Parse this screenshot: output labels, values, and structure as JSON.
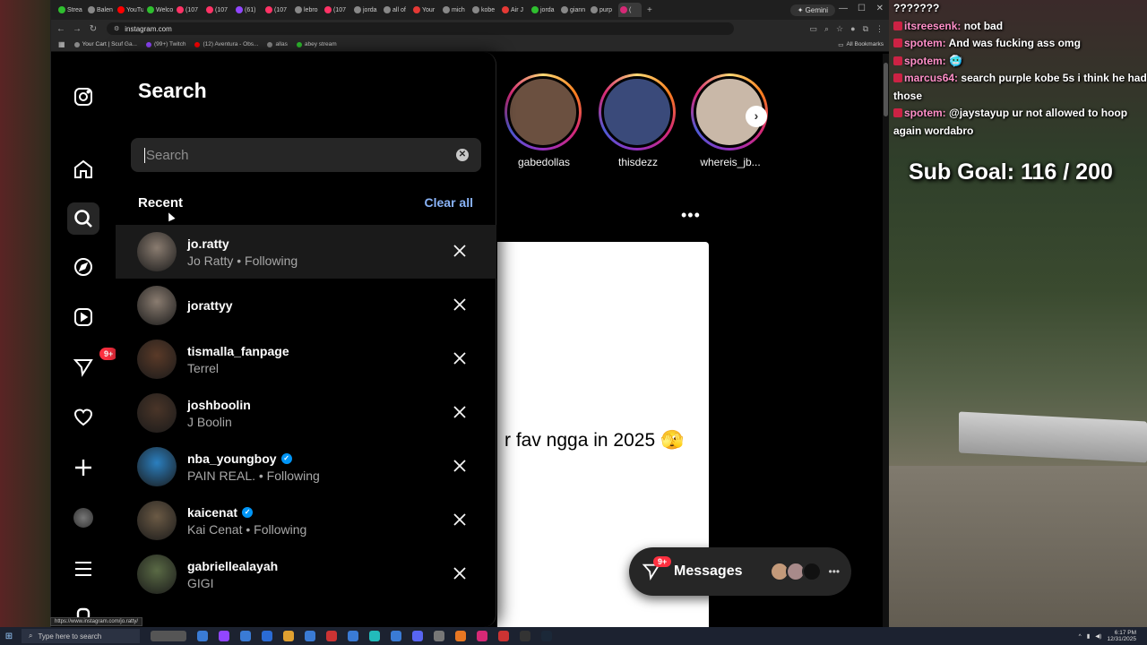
{
  "browser": {
    "tabs": [
      {
        "label": "Strea",
        "color": "#2fbf2f"
      },
      {
        "label": "Balen",
        "color": "#888888"
      },
      {
        "label": "YouTu",
        "color": "#ff0000"
      },
      {
        "label": "Welco",
        "color": "#2fbf2f"
      },
      {
        "label": "(107",
        "color": "#ff3366"
      },
      {
        "label": "(107",
        "color": "#ff3366"
      },
      {
        "label": "(61)",
        "color": "#9146ff"
      },
      {
        "label": "(107",
        "color": "#ff3366"
      },
      {
        "label": "lebro",
        "color": "#888888"
      },
      {
        "label": "(107",
        "color": "#ff3366"
      },
      {
        "label": "jorda",
        "color": "#888888"
      },
      {
        "label": "all of",
        "color": "#888888"
      },
      {
        "label": "Your",
        "color": "#e53935"
      },
      {
        "label": "mich",
        "color": "#888888"
      },
      {
        "label": "kobe",
        "color": "#888888"
      },
      {
        "label": "Air J",
        "color": "#e53935"
      },
      {
        "label": "jorda",
        "color": "#2fbf2f"
      },
      {
        "label": "giann",
        "color": "#888888"
      },
      {
        "label": "purp",
        "color": "#888888"
      },
      {
        "label": "(",
        "color": "#d62976"
      }
    ],
    "gemini_label": "Gemini",
    "url": "instagram.com",
    "bookmarks": [
      "Your Cart | Scuf Ga...",
      "(99+) Twitch",
      "(12) Aventura - Obs...",
      "allas",
      "abey stream"
    ],
    "all_bookmarks_label": "All Bookmarks",
    "status_url": "https://www.instagram.com/jo.ratty/"
  },
  "search_panel": {
    "title": "Search",
    "placeholder": "Search",
    "recent_label": "Recent",
    "clear_all_label": "Clear all",
    "recent": [
      {
        "username": "jo.ratty",
        "subtitle": "Jo Ratty • Following",
        "verified": false,
        "avatar_color": "#8a7c70"
      },
      {
        "username": "jorattyy",
        "subtitle": "",
        "verified": false,
        "avatar_color": "#8a7c70"
      },
      {
        "username": "tismalla_fanpage",
        "subtitle": "Terrel",
        "verified": false,
        "avatar_color": "#5a3a28"
      },
      {
        "username": "joshboolin",
        "subtitle": "J Boolin",
        "verified": false,
        "avatar_color": "#4a3528"
      },
      {
        "username": "nba_youngboy",
        "subtitle": "PAIN REAL. • Following",
        "verified": true,
        "avatar_color": "#2b7fbf"
      },
      {
        "username": "kaicenat",
        "subtitle": "Kai Cenat • Following",
        "verified": true,
        "avatar_color": "#6b5a45"
      },
      {
        "username": "gabriellealayah",
        "subtitle": "GIGI",
        "verified": false,
        "avatar_color": "#5a6a45"
      }
    ]
  },
  "nav": {
    "notifications_badge": "9+"
  },
  "stories": [
    {
      "name": "gabedollas",
      "color": "#6b5040"
    },
    {
      "name": "thisdezz",
      "color": "#3a4a7a"
    },
    {
      "name": "whereis_jb...",
      "color": "#c9b8a8"
    }
  ],
  "post": {
    "caption": "r fav ngga in 2025 🫣"
  },
  "messages": {
    "label": "Messages",
    "badge": "9+"
  },
  "chat": {
    "lines": [
      {
        "user": "",
        "text": "???????"
      },
      {
        "user": "itsreesenk:",
        "text": "not bad"
      },
      {
        "user": "spotem:",
        "text": "And was fucking ass omg"
      },
      {
        "user": "spotem:",
        "text": "🥶"
      },
      {
        "user": "marcus64:",
        "text": "search purple kobe 5s i think he had those"
      },
      {
        "user": "spotem:",
        "text": "@jaystayup ur not allowed to hoop again wordabro"
      }
    ],
    "sub_goal": "Sub Goal:  116 / 200"
  },
  "taskbar": {
    "search_placeholder": "Type here to search",
    "time": "6:17 PM",
    "date": "12/31/2025"
  }
}
